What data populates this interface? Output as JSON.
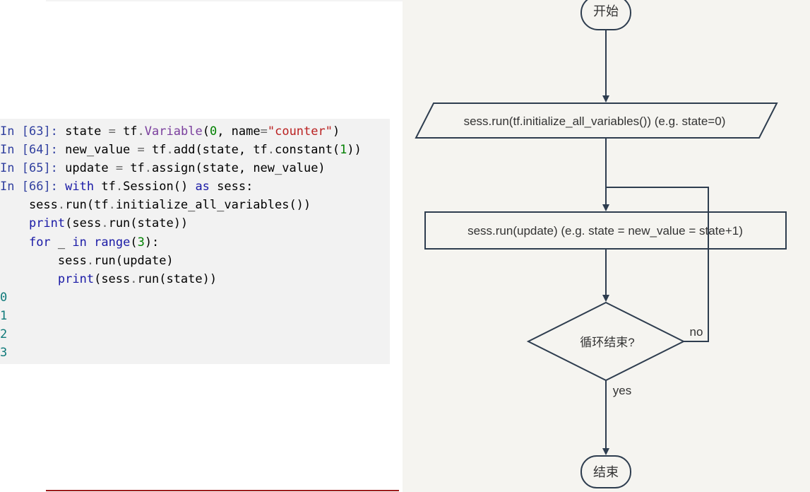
{
  "code": {
    "lines": [
      [
        {
          "t": "In [",
          "c": "p"
        },
        {
          "t": "63",
          "c": "p"
        },
        {
          "t": "]: ",
          "c": "p"
        },
        {
          "t": "state ",
          "c": ""
        },
        {
          "t": "=",
          "c": "o"
        },
        {
          "t": " tf",
          "c": ""
        },
        {
          "t": ".",
          "c": "o"
        },
        {
          "t": "Variable",
          "c": "f"
        },
        {
          "t": "(",
          "c": ""
        },
        {
          "t": "0",
          "c": "n"
        },
        {
          "t": ", name",
          "c": ""
        },
        {
          "t": "=",
          "c": "o"
        },
        {
          "t": "\"counter\"",
          "c": "s"
        },
        {
          "t": ")",
          "c": ""
        }
      ],
      [
        {
          "t": "In [",
          "c": "p"
        },
        {
          "t": "64",
          "c": "p"
        },
        {
          "t": "]: ",
          "c": "p"
        },
        {
          "t": "new_value ",
          "c": ""
        },
        {
          "t": "=",
          "c": "o"
        },
        {
          "t": " tf",
          "c": ""
        },
        {
          "t": ".",
          "c": "o"
        },
        {
          "t": "add(state, tf",
          "c": ""
        },
        {
          "t": ".",
          "c": "o"
        },
        {
          "t": "constant(",
          "c": ""
        },
        {
          "t": "1",
          "c": "n"
        },
        {
          "t": "))",
          "c": ""
        }
      ],
      [
        {
          "t": "In [",
          "c": "p"
        },
        {
          "t": "65",
          "c": "p"
        },
        {
          "t": "]: ",
          "c": "p"
        },
        {
          "t": "update ",
          "c": ""
        },
        {
          "t": "=",
          "c": "o"
        },
        {
          "t": " tf",
          "c": ""
        },
        {
          "t": ".",
          "c": "o"
        },
        {
          "t": "assign(state, new_value)",
          "c": ""
        }
      ],
      [
        {
          "t": "In [",
          "c": "p"
        },
        {
          "t": "66",
          "c": "p"
        },
        {
          "t": "]: ",
          "c": "p"
        },
        {
          "t": "with",
          "c": "kw"
        },
        {
          "t": " tf",
          "c": ""
        },
        {
          "t": ".",
          "c": "o"
        },
        {
          "t": "Session()",
          "c": ""
        },
        {
          "t": " as",
          "c": "kw"
        },
        {
          "t": " sess:",
          "c": ""
        }
      ],
      [
        {
          "t": "    sess",
          "c": ""
        },
        {
          "t": ".",
          "c": "o"
        },
        {
          "t": "run(tf",
          "c": ""
        },
        {
          "t": ".",
          "c": "o"
        },
        {
          "t": "initialize_all_variables())",
          "c": ""
        }
      ],
      [
        {
          "t": "    ",
          "c": ""
        },
        {
          "t": "print",
          "c": "b"
        },
        {
          "t": "(sess",
          "c": ""
        },
        {
          "t": ".",
          "c": "o"
        },
        {
          "t": "run(state))",
          "c": ""
        }
      ],
      [
        {
          "t": "    ",
          "c": ""
        },
        {
          "t": "for",
          "c": "kw"
        },
        {
          "t": " _ ",
          "c": ""
        },
        {
          "t": "in",
          "c": "kw"
        },
        {
          "t": " ",
          "c": ""
        },
        {
          "t": "range",
          "c": "b"
        },
        {
          "t": "(",
          "c": ""
        },
        {
          "t": "3",
          "c": "n"
        },
        {
          "t": "):",
          "c": ""
        }
      ],
      [
        {
          "t": "        sess",
          "c": ""
        },
        {
          "t": ".",
          "c": "o"
        },
        {
          "t": "run(update)",
          "c": ""
        }
      ],
      [
        {
          "t": "        ",
          "c": ""
        },
        {
          "t": "print",
          "c": "b"
        },
        {
          "t": "(sess",
          "c": ""
        },
        {
          "t": ".",
          "c": "o"
        },
        {
          "t": "run(state))",
          "c": ""
        }
      ],
      [
        {
          "t": "0",
          "c": "out"
        }
      ],
      [
        {
          "t": "1",
          "c": "out"
        }
      ],
      [
        {
          "t": "2",
          "c": "out"
        }
      ],
      [
        {
          "t": "3",
          "c": "out"
        }
      ]
    ]
  },
  "flowchart": {
    "start_label": "开始",
    "init_label": "sess.run(tf.initialize_all_variables()) (e.g. state=0)",
    "update_label": "sess.run(update) (e.g. state = new_value = state+1)",
    "decision_label": "循环结束?",
    "no_label": "no",
    "yes_label": "yes",
    "end_label": "结束"
  },
  "colors": {
    "stroke": "#2e3d4f",
    "text": "#333333",
    "panel_bg": "#f5f4f0",
    "code_bg": "#f2f2f2"
  }
}
